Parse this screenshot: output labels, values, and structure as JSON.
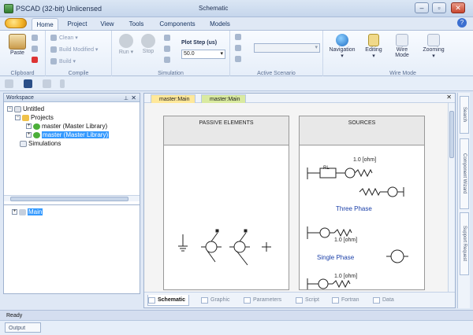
{
  "window": {
    "app_title": "PSCAD (32-bit) Unlicensed",
    "context_title": "Schematic",
    "min": "–",
    "restore": "▫",
    "close": "✕"
  },
  "ribbon_tabs": [
    "Home",
    "Project",
    "View",
    "Tools",
    "Components",
    "Models"
  ],
  "ribbon": {
    "clipboard": {
      "paste": "Paste",
      "group": "Clipboard"
    },
    "compile": {
      "clean": "Clean",
      "build_modified": "Build Modified",
      "build": "Build",
      "group": "Compile"
    },
    "simulation": {
      "run": "Run",
      "stop": "Stop",
      "plot_step_label": "Plot Step (us)",
      "plot_step_value": "50.0",
      "group": "Simulation"
    },
    "active_scenario": {
      "group": "Active Scenario"
    },
    "wire_mode": {
      "navigation": "Navigation",
      "editing": "Editing",
      "wire_mode": "Wire\nMode",
      "zooming": "Zooming",
      "group": "Wire Mode"
    }
  },
  "workspace": {
    "title": "Workspace",
    "pin": "⊥",
    "close": "✕",
    "tree": {
      "untitled": "Untitled",
      "projects": "Projects",
      "master1": "master (Master Library)",
      "master2": "master (Master Library)",
      "simulations": "Simulations"
    },
    "bottom_tree": {
      "main": "Main"
    }
  },
  "doc_tabs": [
    "master:Main",
    "master:Main"
  ],
  "canvas": {
    "passive_header": "PASSIVE ELEMENTS",
    "sources_header": "SOURCES",
    "rl_label": "RL",
    "ohm1": "1.0 [ohm]",
    "three_phase": "Three Phase",
    "ohm2": "1.0 [ohm]",
    "single_phase": "Single Phase",
    "ohm3": "1.0 [ohm]"
  },
  "bottom_tabs": [
    "Schematic",
    "Graphic",
    "Parameters",
    "Script",
    "Fortran",
    "Data"
  ],
  "side_tabs": [
    "Search",
    "Component Wizard",
    "Support Request"
  ],
  "status": {
    "text": "Ready",
    "output": "Output"
  },
  "colors": {
    "accent": "#3399ff",
    "tab_yellow": "#ffe89a",
    "tab_green": "#d9eaa0"
  }
}
